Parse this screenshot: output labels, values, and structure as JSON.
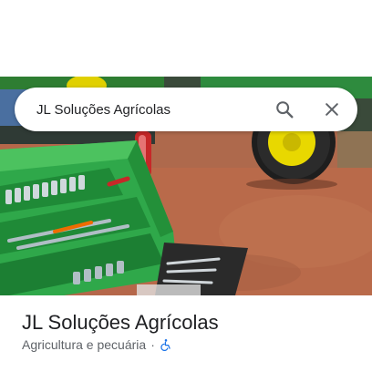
{
  "search": {
    "query": "JL Soluções Agrícolas",
    "search_icon": "search-icon",
    "close_icon": "close-icon"
  },
  "place": {
    "name": "JL Soluções Agrícolas",
    "category": "Agricultura e pecuária",
    "separator": "·",
    "accessibility_icon": "wheelchair-accessible-icon",
    "accessibility_color": "#1a73e8"
  },
  "photo": {
    "subject": "green-toolbox-and-tractor-photo"
  }
}
